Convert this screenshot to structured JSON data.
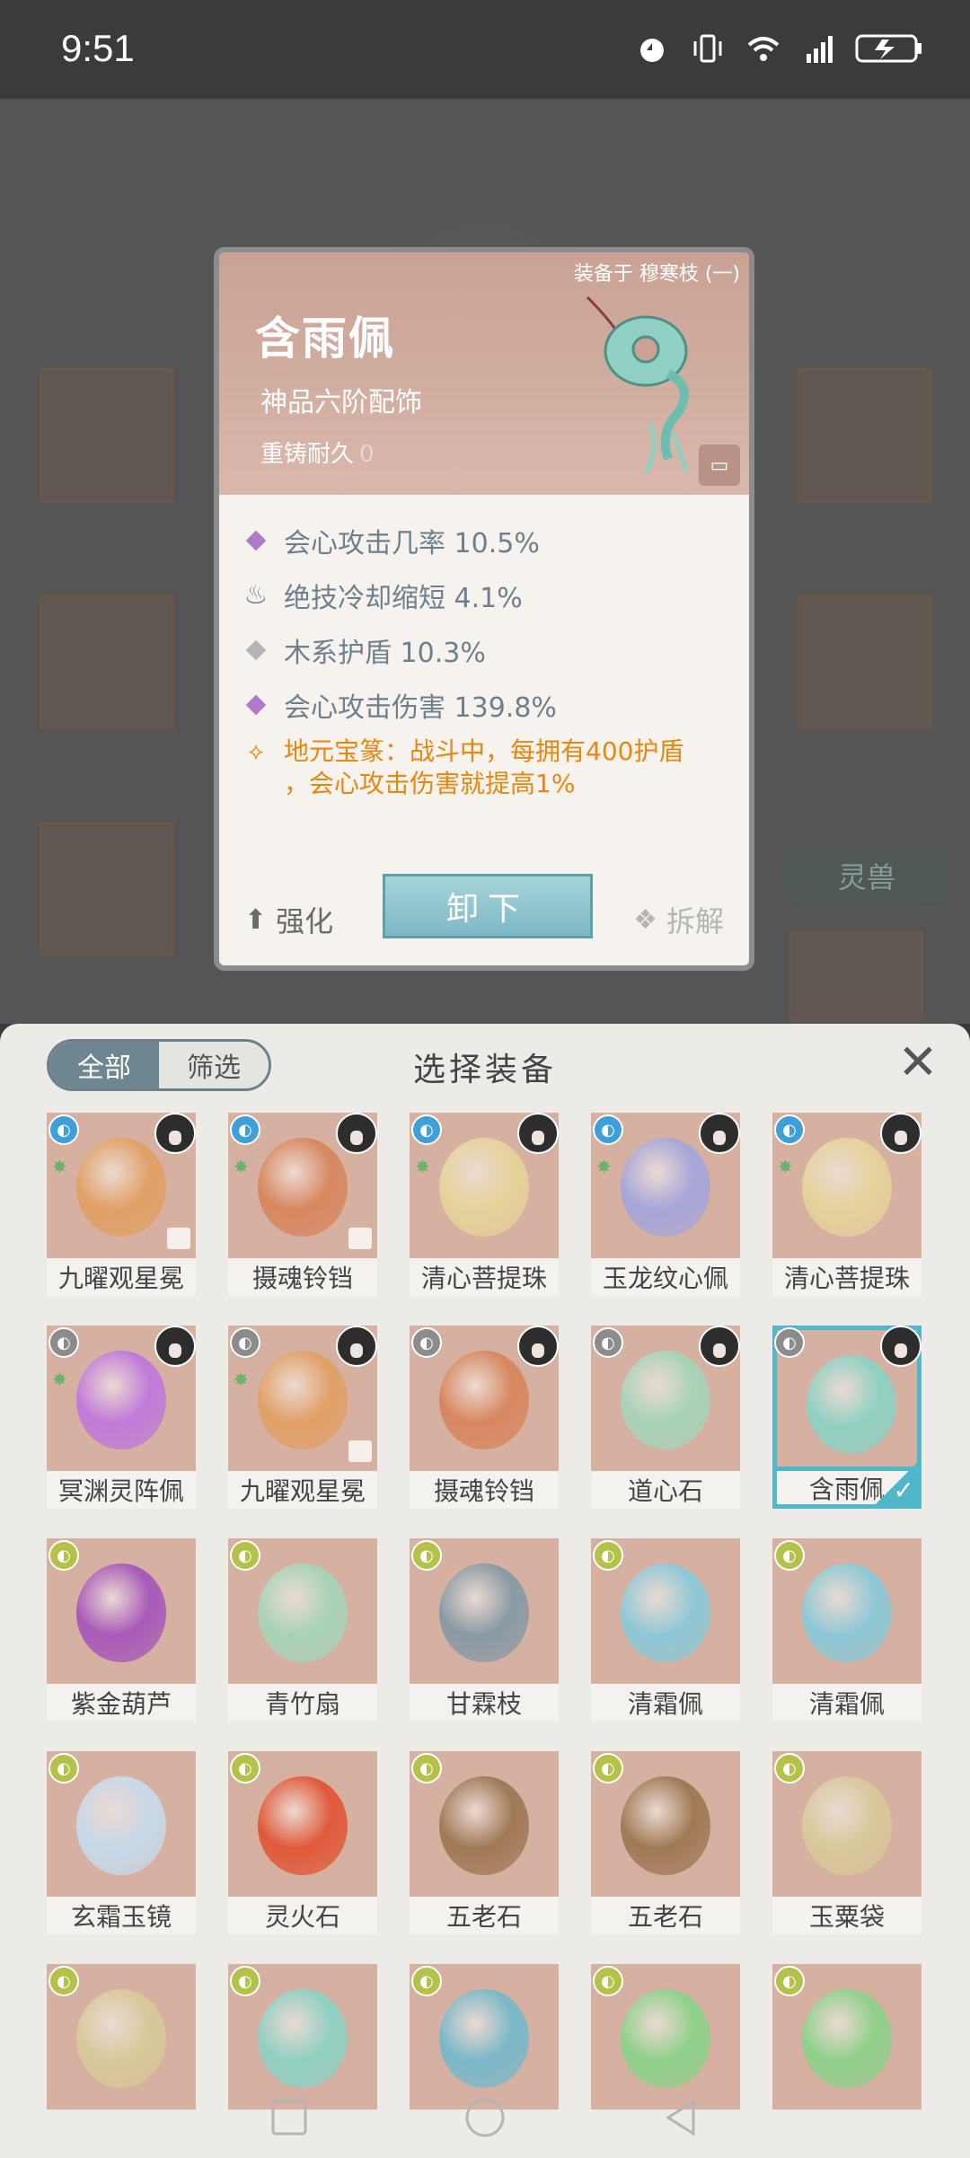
{
  "status_bar": {
    "time": "9:51",
    "icons": [
      "alarm-icon",
      "vibrate-icon",
      "wifi-icon",
      "4g-signal-icon",
      "battery-charging-icon"
    ]
  },
  "background_scene": {
    "beast_button_label": "灵兽"
  },
  "item_popup": {
    "equipped_tag": "装备于 穆寒枝 (一)",
    "name": "含雨佩",
    "grade": "神品六阶配饰",
    "recast_label": "重铸耐久",
    "recast_value": "0",
    "attributes": [
      {
        "icon": "purple-diamond-icon",
        "color": "#b07acb",
        "text": "会心攻击几率 10.5%"
      },
      {
        "icon": "flame-cooldown-icon",
        "color": "#6e7f8d",
        "text": "绝技冷却缩短 4.1%"
      },
      {
        "icon": "grey-diamond-icon",
        "color": "#b5b5b5",
        "text": "木系护盾 10.3%"
      },
      {
        "icon": "purple-diamond-icon",
        "color": "#b07acb",
        "text": "会心攻击伤害 139.8%"
      }
    ],
    "special": {
      "icon": "special-effect-icon",
      "line1": "地元宝篆：战斗中，每拥有400护盾",
      "line2": "，会心攻击伤害就提高1%"
    },
    "actions": {
      "strengthen": "强化",
      "unequip": "卸下",
      "decompose": "拆解"
    }
  },
  "select_panel": {
    "title": "选择装备",
    "filter_tabs": [
      "全部",
      "筛选"
    ],
    "close_icon": "close-icon",
    "items": [
      {
        "name": "九曜观星冕",
        "elem": "#3f9fd8",
        "avatar": true,
        "star": true,
        "locked": true,
        "tint": "#e0a066"
      },
      {
        "name": "摄魂铃铛",
        "elem": "#3f9fd8",
        "avatar": true,
        "star": true,
        "locked": true,
        "tint": "#d7875f"
      },
      {
        "name": "清心菩提珠",
        "elem": "#3f9fd8",
        "avatar": true,
        "star": true,
        "locked": false,
        "tint": "#e5d29a"
      },
      {
        "name": "玉龙纹心佩",
        "elem": "#3f9fd8",
        "avatar": true,
        "star": true,
        "locked": false,
        "tint": "#a6a6d8"
      },
      {
        "name": "清心菩提珠",
        "elem": "#3f9fd8",
        "avatar": true,
        "star": true,
        "locked": false,
        "tint": "#e5d29a"
      },
      {
        "name": "冥渊灵阵佩",
        "elem": "#8c8c8c",
        "avatar": true,
        "star": true,
        "locked": false,
        "tint": "#c07ad8"
      },
      {
        "name": "九曜观星冕",
        "elem": "#8c8c8c",
        "avatar": true,
        "star": true,
        "locked": true,
        "tint": "#e0a066"
      },
      {
        "name": "摄魂铃铛",
        "elem": "#8c8c8c",
        "avatar": true,
        "star": false,
        "locked": false,
        "tint": "#d7875f"
      },
      {
        "name": "道心石",
        "elem": "#8c8c8c",
        "avatar": true,
        "star": false,
        "locked": false,
        "tint": "#a8d2b8"
      },
      {
        "name": "含雨佩",
        "elem": "#8c8c8c",
        "avatar": true,
        "star": false,
        "locked": false,
        "selected": true,
        "tint": "#8fd0c2"
      },
      {
        "name": "紫金葫芦",
        "elem": "#b4c24a",
        "avatar": false,
        "star": false,
        "locked": false,
        "tint": "#a85ab8"
      },
      {
        "name": "青竹扇",
        "elem": "#b4c24a",
        "avatar": false,
        "star": false,
        "locked": false,
        "tint": "#a8d2b8"
      },
      {
        "name": "甘霖枝",
        "elem": "#b4c24a",
        "avatar": false,
        "star": false,
        "locked": false,
        "tint": "#8a9aa4"
      },
      {
        "name": "清霜佩",
        "elem": "#b4c24a",
        "avatar": false,
        "star": false,
        "locked": false,
        "tint": "#8ec8d6"
      },
      {
        "name": "清霜佩",
        "elem": "#b4c24a",
        "avatar": false,
        "star": false,
        "locked": false,
        "tint": "#8ec8d6"
      },
      {
        "name": "玄霜玉镜",
        "elem": "#b4c24a",
        "avatar": false,
        "star": false,
        "locked": false,
        "tint": "#c8d8e8"
      },
      {
        "name": "灵火石",
        "elem": "#b4c24a",
        "avatar": false,
        "star": false,
        "locked": false,
        "tint": "#e05a3a"
      },
      {
        "name": "五老石",
        "elem": "#b4c24a",
        "avatar": false,
        "star": false,
        "locked": false,
        "tint": "#a07a56"
      },
      {
        "name": "五老石",
        "elem": "#b4c24a",
        "avatar": false,
        "star": false,
        "locked": false,
        "tint": "#a07a56"
      },
      {
        "name": "玉粟袋",
        "elem": "#b4c24a",
        "avatar": false,
        "star": false,
        "locked": false,
        "tint": "#d8c89a"
      },
      {
        "name": "",
        "elem": "#b4c24a",
        "avatar": false,
        "star": false,
        "locked": false,
        "tint": "#d8c89a"
      },
      {
        "name": "",
        "elem": "#b4c24a",
        "avatar": false,
        "star": false,
        "locked": false,
        "tint": "#8fd0c2"
      },
      {
        "name": "",
        "elem": "#b4c24a",
        "avatar": false,
        "star": false,
        "locked": false,
        "tint": "#7ab8c8"
      },
      {
        "name": "",
        "elem": "#b4c24a",
        "avatar": false,
        "star": false,
        "locked": false,
        "tint": "#8fd08a"
      },
      {
        "name": "",
        "elem": "#b4c24a",
        "avatar": false,
        "star": false,
        "locked": false,
        "tint": "#8fd08a"
      }
    ]
  },
  "nav_bar": {
    "buttons": [
      "recents-square-icon",
      "home-circle-icon",
      "back-triangle-icon"
    ]
  }
}
